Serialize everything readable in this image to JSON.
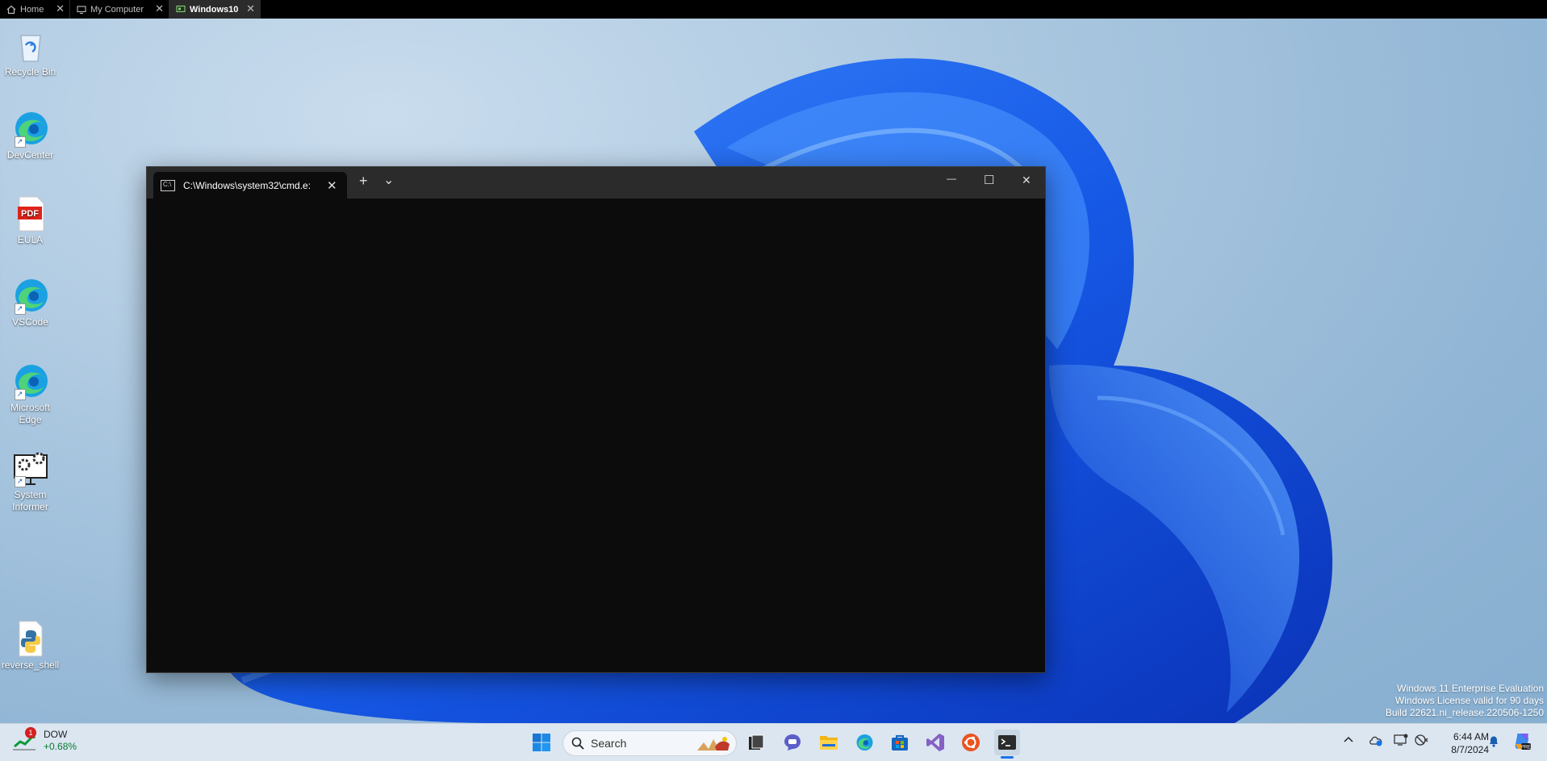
{
  "vm_tabs": [
    {
      "label": "Home",
      "icon": "home-icon"
    },
    {
      "label": "My Computer",
      "icon": "monitor-icon"
    },
    {
      "label": "Windows10",
      "icon": "vm-icon",
      "active": true
    }
  ],
  "desktop_icons": [
    {
      "label": "Recycle Bin",
      "icon": "recycle-bin-icon"
    },
    {
      "label": "DevCenter",
      "icon": "edge-icon"
    },
    {
      "label": "EULA",
      "icon": "pdf-icon",
      "badge": "PDF"
    },
    {
      "label": "VSCode",
      "icon": "edge-icon"
    },
    {
      "label": "Microsoft Edge",
      "icon": "edge-icon"
    },
    {
      "label": "System Informer",
      "icon": "system-informer-icon"
    },
    {
      "label": "reverse_shell",
      "icon": "python-file-icon"
    }
  ],
  "terminal": {
    "tab_title": "C:\\Windows\\system32\\cmd.e:",
    "new_tab": "+",
    "dropdown": "⌄",
    "minimize": "—",
    "maximize": "☐",
    "close": "✕"
  },
  "watermark": {
    "line1": "Windows 11 Enterprise Evaluation",
    "line2": "Windows License valid for 90 days",
    "line3": "Build 22621.ni_release.220506-1250"
  },
  "taskbar": {
    "widget": {
      "badge": "1",
      "name": "DOW",
      "change": "+0.68%"
    },
    "search_placeholder": "Search",
    "apps": [
      "start-icon",
      "task-view-icon",
      "teams-chat-icon",
      "file-explorer-icon",
      "edge-icon",
      "store-icon",
      "visual-studio-icon",
      "ubuntu-icon",
      "terminal-icon"
    ],
    "clock": {
      "time": "6:44 AM",
      "date": "8/7/2024"
    }
  },
  "colors": {
    "accent": "#1a73e8",
    "terminal_bg": "#0c0c0c",
    "titlebar_bg": "#2b2b2b",
    "stock_up": "#0b7a2f"
  }
}
